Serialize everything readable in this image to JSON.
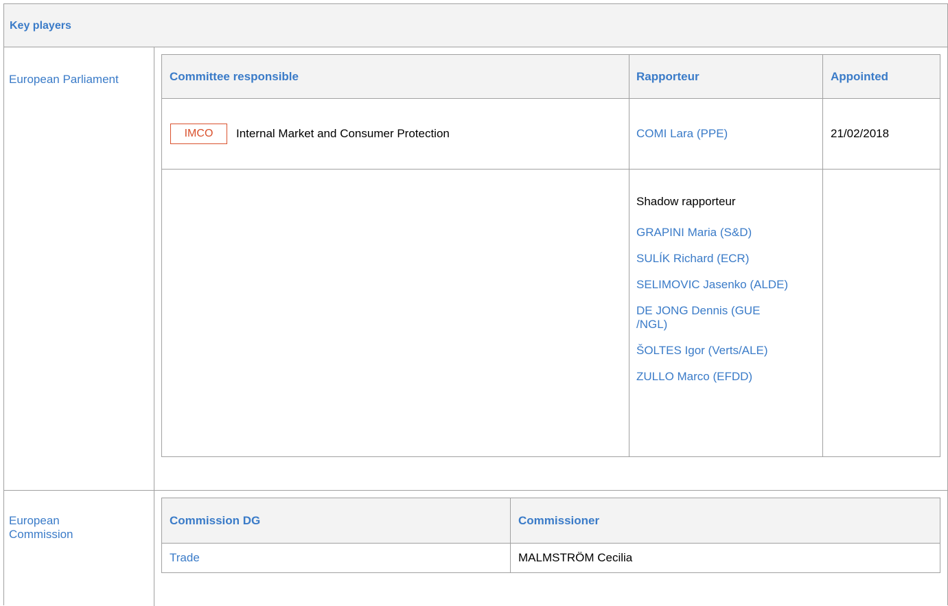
{
  "header": {
    "title": "Key players"
  },
  "european_parliament": {
    "label": "European Parliament",
    "columns": {
      "committee": "Committee responsible",
      "rapporteur": "Rapporteur",
      "appointed": "Appointed"
    },
    "committee": {
      "code": "IMCO",
      "name": "Internal Market and Consumer Protection",
      "rapporteur": "COMI Lara (PPE)",
      "appointed": "21/02/2018"
    },
    "shadow": {
      "title": "Shadow rapporteur",
      "members": [
        "GRAPINI Maria (S&D)",
        "SULÍK Richard (ECR)",
        "SELIMOVIC Jasenko (ALDE)",
        "DE JONG Dennis (GUE /NGL)",
        "ŠOLTES Igor (Verts/ALE)",
        "ZULLO Marco (EFDD)"
      ]
    }
  },
  "european_commission": {
    "label": "European Commission",
    "columns": {
      "dg": "Commission DG",
      "commissioner": "Commissioner"
    },
    "row": {
      "dg": "Trade",
      "commissioner": "MALMSTRÖM Cecilia"
    }
  }
}
